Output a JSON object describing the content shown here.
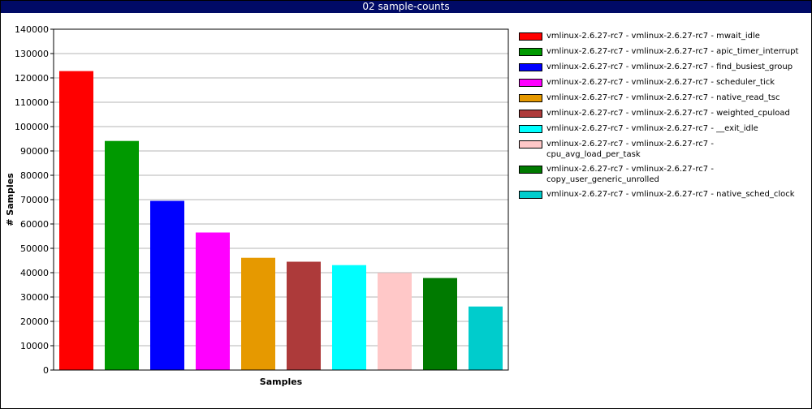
{
  "window": {
    "title": "02 sample-counts"
  },
  "chart_data": {
    "type": "bar",
    "xlabel": "Samples",
    "ylabel": "# Samples",
    "ylim": [
      0,
      140000
    ],
    "yticks": [
      "0",
      "10000",
      "20000",
      "30000",
      "40000",
      "50000",
      "60000",
      "70000",
      "80000",
      "90000",
      "100000",
      "110000",
      "120000",
      "130000",
      "140000"
    ],
    "grid": true,
    "legend_position": "right",
    "series": [
      {
        "name": "vmlinux-2.6.27-rc7 - vmlinux-2.6.27-rc7 - mwait_idle",
        "value": 122800,
        "color": "#ff0000"
      },
      {
        "name": "vmlinux-2.6.27-rc7 - vmlinux-2.6.27-rc7 - apic_timer_interrupt",
        "value": 94100,
        "color": "#009900"
      },
      {
        "name": "vmlinux-2.6.27-rc7 - vmlinux-2.6.27-rc7 - find_busiest_group",
        "value": 69500,
        "color": "#0000ff"
      },
      {
        "name": "vmlinux-2.6.27-rc7 - vmlinux-2.6.27-rc7 - scheduler_tick",
        "value": 56500,
        "color": "#ff00ff"
      },
      {
        "name": "vmlinux-2.6.27-rc7 - vmlinux-2.6.27-rc7 - native_read_tsc",
        "value": 46100,
        "color": "#e69900"
      },
      {
        "name": "vmlinux-2.6.27-rc7 - vmlinux-2.6.27-rc7 - weighted_cpuload",
        "value": 44500,
        "color": "#ad3a3a"
      },
      {
        "name": "vmlinux-2.6.27-rc7 - vmlinux-2.6.27-rc7 - __exit_idle",
        "value": 43100,
        "color": "#00ffff"
      },
      {
        "name": "vmlinux-2.6.27-rc7 - vmlinux-2.6.27-rc7 - cpu_avg_load_per_task",
        "value": 39900,
        "color": "#ffc8c8"
      },
      {
        "name": "vmlinux-2.6.27-rc7 - vmlinux-2.6.27-rc7 - copy_user_generic_unrolled",
        "value": 37800,
        "color": "#007a00"
      },
      {
        "name": "vmlinux-2.6.27-rc7 - vmlinux-2.6.27-rc7 - native_sched_clock",
        "value": 26100,
        "color": "#00cccc"
      }
    ]
  }
}
